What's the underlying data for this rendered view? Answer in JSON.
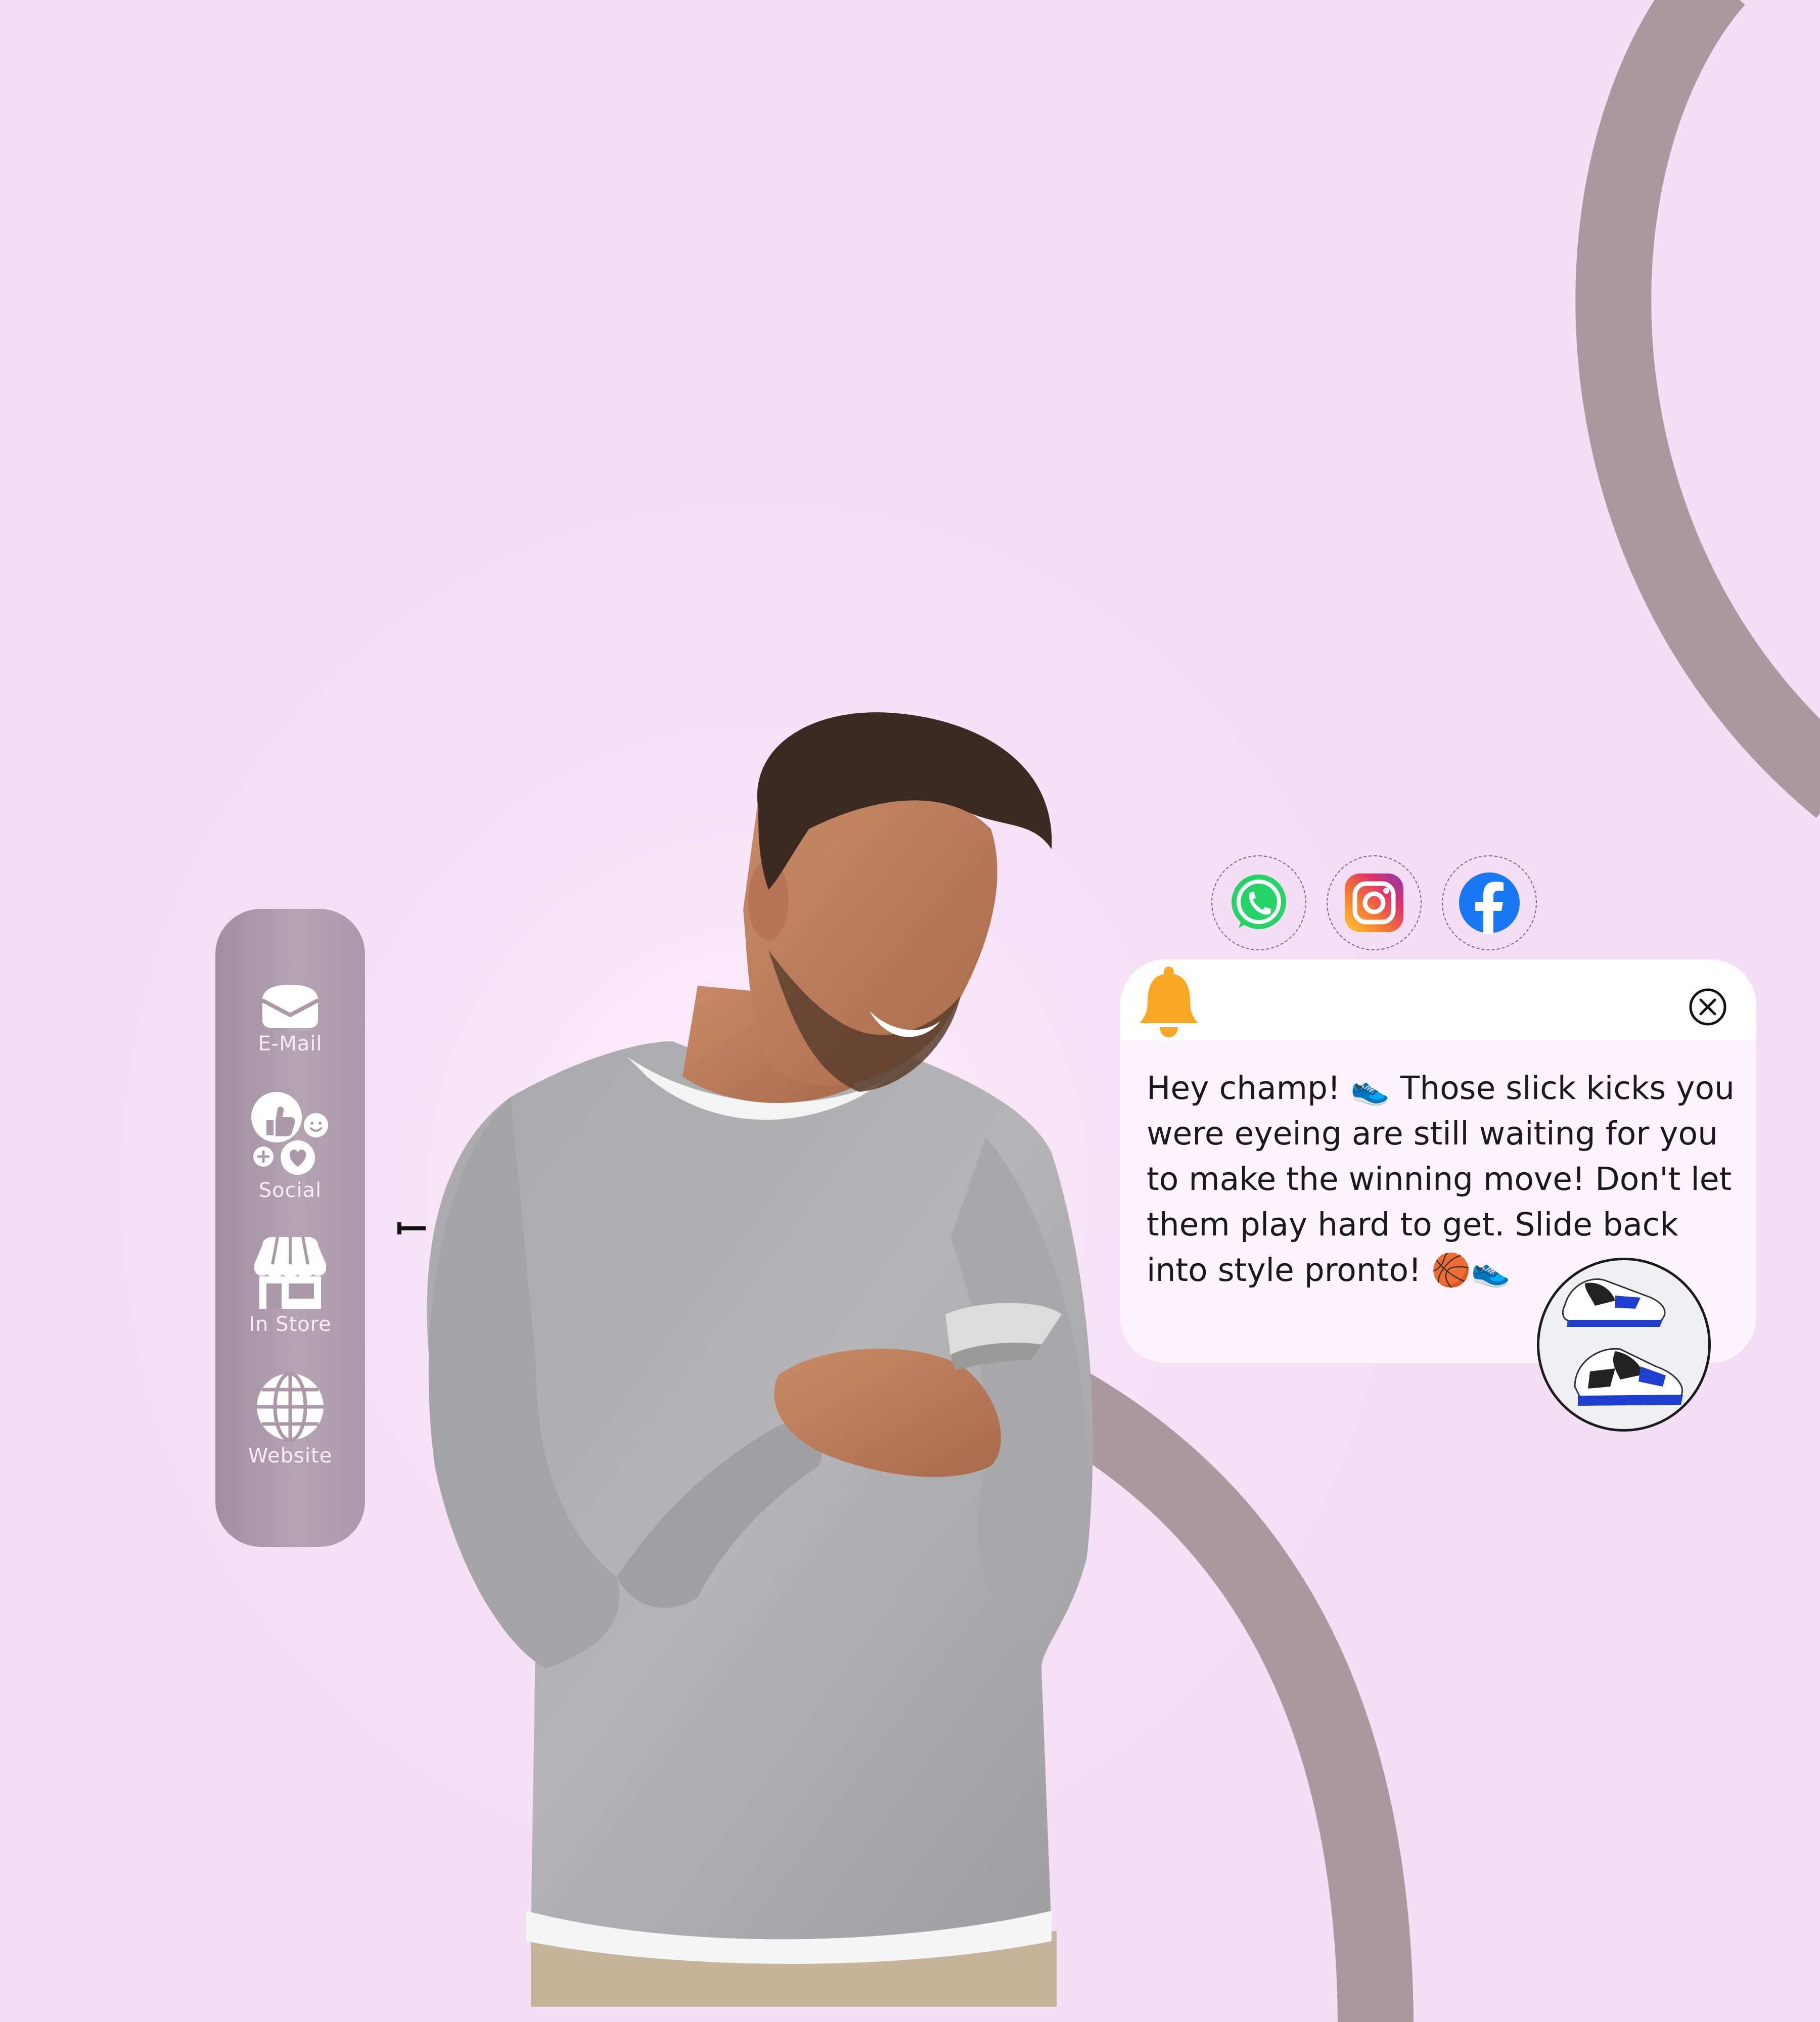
{
  "sidebar": {
    "items": [
      {
        "label": "E-Mail",
        "icon": "envelope-icon"
      },
      {
        "label": "Social",
        "icon": "social-reactions-icon"
      },
      {
        "label": "In Store",
        "icon": "storefront-icon"
      },
      {
        "label": "Website",
        "icon": "globe-icon"
      }
    ]
  },
  "social_channels": [
    {
      "icon": "whatsapp-icon",
      "color": "#25d366"
    },
    {
      "icon": "instagram-icon",
      "color": "#e1306c"
    },
    {
      "icon": "facebook-icon",
      "color": "#1877f2"
    }
  ],
  "notification": {
    "icon": "bell-icon",
    "bell_color": "#f9a825",
    "message": "Hey champ! 👟 Those slick kicks you were eyeing are still waiting for you to make the winning move! Don't let them play hard to get. Slide back into style pronto! 🏀👟",
    "close_icon": "close-circle-icon",
    "product_image": "sneaker-thumbnail"
  },
  "colors": {
    "background": "#f4def5",
    "arc": "#a9999f",
    "sidebar": "#ab98a9"
  }
}
